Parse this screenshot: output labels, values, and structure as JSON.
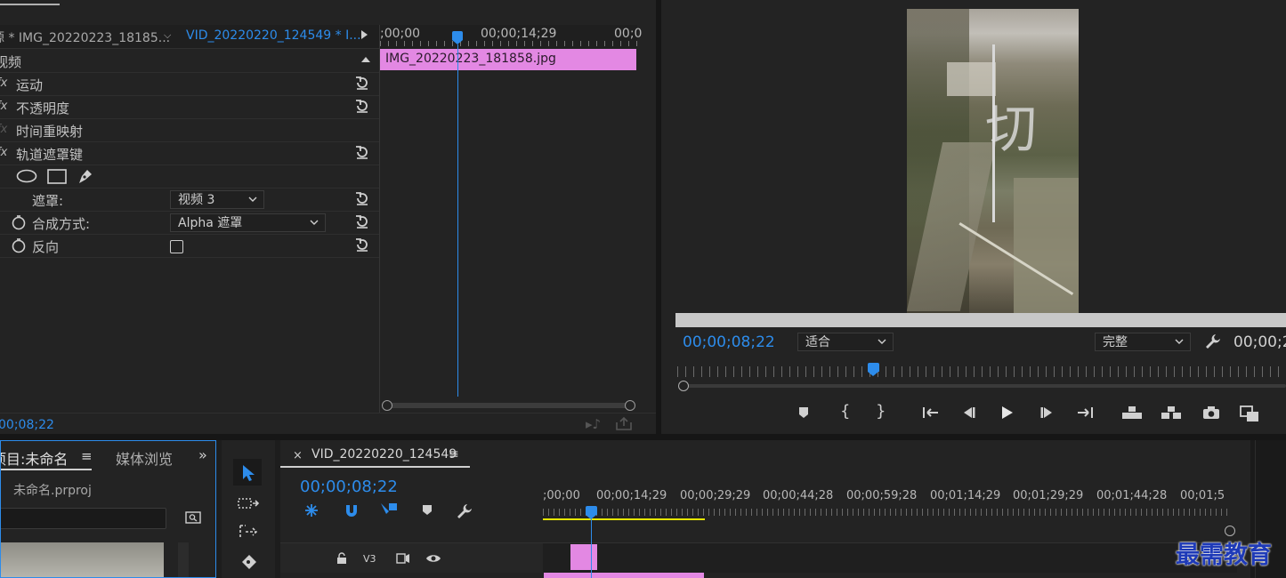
{
  "effect_controls": {
    "tab_source": "源 * IMG_20220223_18185...",
    "tab_active": "VID_20220220_124549 * I...",
    "section_video": "视频",
    "effects": [
      {
        "fx": "fx",
        "label": "运动"
      },
      {
        "fx": "fx",
        "label": "不透明度"
      },
      {
        "fx": "fx",
        "label": "时间重映射"
      },
      {
        "fx": "fx",
        "label": "轨道遮罩键"
      }
    ],
    "mask_label": "遮罩:",
    "mask_value": "视频 3",
    "composite_label": "合成方式:",
    "composite_value": "Alpha 遮罩",
    "reverse_label": "反向",
    "timecode": "00;08;22",
    "ruler": ";00;00",
    "ruler_mid": "00;00;14;29",
    "ruler_end": "00;0",
    "clip_name": "IMG_20220223_181858.jpg"
  },
  "program_monitor": {
    "timecode": "00;00;08;22",
    "fit_value": "适合",
    "quality_value": "完整",
    "duration": "00;00;2",
    "overlay_text": "切"
  },
  "project_panel": {
    "tab_project": "项目:未命名",
    "tab_media": "媒体浏览",
    "file_name": "未命名.prproj"
  },
  "timeline": {
    "sequence_name": "VID_20220220_124549",
    "timecode": "00;00;08;22",
    "ruler_labels": [
      ";00;00",
      "00;00;14;29",
      "00;00;29;29",
      "00;00;44;28",
      "00;00;59;28",
      "00;01;14;29",
      "00;01;29;29",
      "00;01;44;28",
      "00;01;5"
    ],
    "track_v3": "V3"
  },
  "watermark": "最需教育",
  "colors": {
    "accent": "#2d8ceb",
    "clip": "#e388e3",
    "work_area": "#e6e600"
  }
}
